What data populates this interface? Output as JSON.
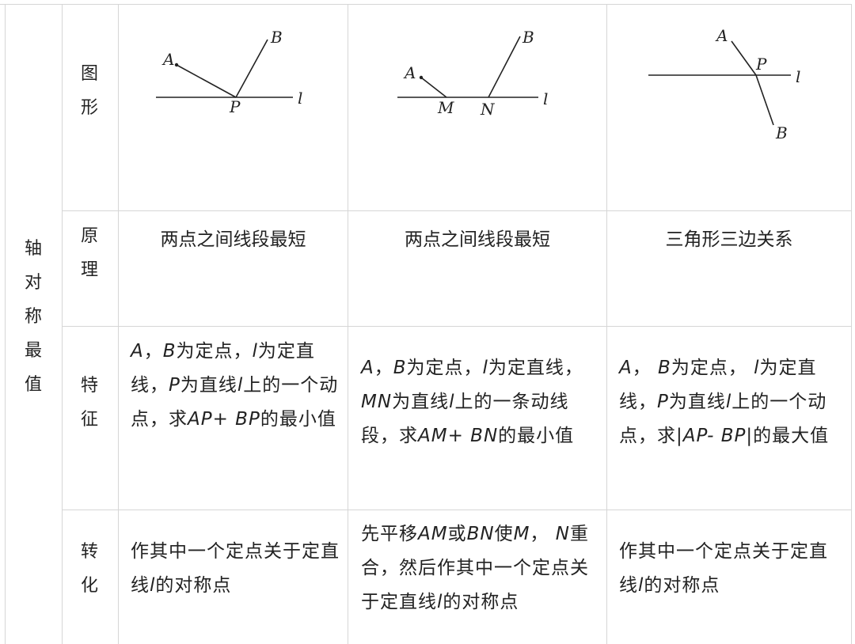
{
  "category": "轴对称最值",
  "row_headers": [
    "图形",
    "原理",
    "特征",
    "转化"
  ],
  "figures": [
    {
      "labels": {
        "A": "A",
        "B": "B",
        "P": "P",
        "l": "l"
      }
    },
    {
      "labels": {
        "A": "A",
        "B": "B",
        "M": "M",
        "N": "N",
        "l": "l"
      }
    },
    {
      "labels": {
        "A": "A",
        "B": "B",
        "P": "P",
        "l": "l"
      }
    }
  ],
  "principles": [
    "两点之间线段最短",
    "两点之间线段最短",
    "三角形三边关系"
  ],
  "features": [
    [
      "A",
      "，",
      "B",
      "为定点，",
      "l",
      "为定直线，",
      "P",
      "为直线",
      "l",
      "上的一个动点，求",
      "AP+ BP",
      "的最小值"
    ],
    [
      "A",
      "，",
      "B",
      "为定点，",
      "l",
      "为定直线，",
      "MN",
      "为直线",
      "l",
      "上的一条动线段，求",
      "AM+ BN",
      "的最小值"
    ],
    [
      "A",
      "， ",
      "B",
      "为定点， ",
      "l",
      "为定直线，",
      "P",
      "为直线",
      "l",
      "上的一个动点，求|",
      "AP- BP",
      "|的最大值"
    ]
  ],
  "transforms": [
    [
      "作其中一个定点关于定直线",
      "l",
      "的对称点"
    ],
    [
      "先平移",
      "AM",
      "或",
      "BN",
      "使",
      "M",
      "， ",
      "N",
      "重合，然后作其中一个定点关于定直线",
      "l",
      "的对称点"
    ],
    [
      "作其中一个定点关于定直线",
      "l",
      "的对称点"
    ]
  ]
}
